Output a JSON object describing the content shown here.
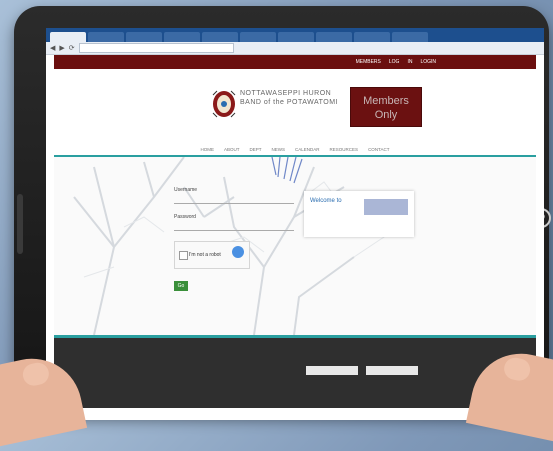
{
  "browser": {
    "tabs": [
      "",
      "",
      "",
      "",
      "",
      "",
      "",
      "",
      "",
      ""
    ],
    "active_tab_label": "",
    "address": ""
  },
  "site": {
    "topbar": [
      "MEMBERS",
      "LOG",
      "IN",
      "LOGIN"
    ],
    "org": {
      "line1": "NOTTAWASEPPI HURON",
      "line2": "BAND of the POTAWATOMI",
      "tagline": ""
    },
    "members_only": {
      "line1": "Members",
      "line2": "Only"
    },
    "nav": [
      "HOME",
      "ABOUT",
      "DEPT",
      "NEWS",
      "CALENDAR",
      "RESOURCES",
      "CONTACT"
    ],
    "login": {
      "user_label": "Username",
      "forgot_label": "",
      "password_label": "Password",
      "captcha_text": "I'm not a robot",
      "submit_label": "Go",
      "register_text": "",
      "extra_link": ""
    },
    "card": {
      "title": "Welcome to",
      "line1": "",
      "line2": ""
    },
    "footer": {
      "col1": [
        "",
        "",
        ""
      ],
      "col2": [
        "",
        ""
      ],
      "head1": "",
      "head2": "",
      "select1": "",
      "select2": ""
    }
  },
  "colors": {
    "brand": "#6b0f0f",
    "accent": "#2a9fa0",
    "browser": "#1d4f8e"
  }
}
